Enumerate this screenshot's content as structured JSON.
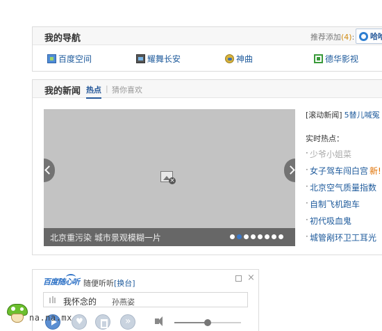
{
  "my_nav": {
    "title": "我的导航",
    "recommend_prefix": "推荐添加",
    "recommend_count": "(4)",
    "recommend_suffix": ":",
    "quick_add_label": "哈哈",
    "links": [
      {
        "label": "百度空间",
        "icon": "baidu-space-icon"
      },
      {
        "label": "耀舞长安",
        "icon": "dance-icon"
      },
      {
        "label": "神曲",
        "icon": "song-icon"
      },
      {
        "label": "德华影视",
        "icon": "dehua-video-icon"
      }
    ]
  },
  "my_news": {
    "title": "我的新闻",
    "tab_hot": "热点",
    "separator": "|",
    "tab_like": "猜你喜欢",
    "slider": {
      "caption": "北京重污染  城市景观模糊一片",
      "dot_count": 8,
      "active_dot": 1
    },
    "rolling_label": "[滚动新闻]",
    "rolling_link": "5替儿喊冤",
    "rolling_bar": "|",
    "hot_title": "实时热点：",
    "hot_items": [
      {
        "text": "少爷小姐菜"
      },
      {
        "text": "女子驾车闯白宫",
        "badge": "新!"
      },
      {
        "text": "北京空气质量指数"
      },
      {
        "text": "自制飞机跑车"
      },
      {
        "text": "初代吸血鬼"
      },
      {
        "text": "城管剐环卫工耳光"
      }
    ]
  },
  "radio": {
    "logo_text": "百度随心听",
    "subtitle_prefix": "随便听听",
    "subtitle_link": "[换台]",
    "song_name": "我怀念的",
    "artist": "孙燕姿",
    "volume": 0.5
  },
  "watermark": {
    "text": "na.na.mx"
  },
  "colors": {
    "link": "#1f5b9c",
    "accent": "#245799",
    "new_badge": "#e07000",
    "slider_bg": "#c3c3c3"
  }
}
